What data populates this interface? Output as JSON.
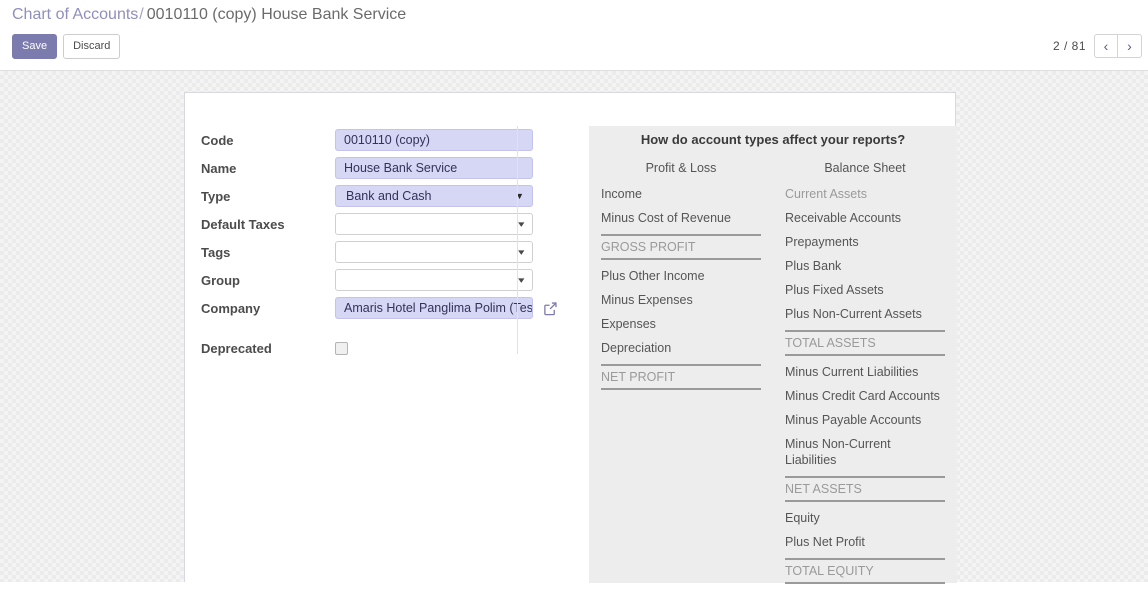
{
  "breadcrumb": {
    "root": "Chart of Accounts",
    "separator": "/",
    "current": "0010110 (copy) House Bank Service"
  },
  "toolbar": {
    "save_label": "Save",
    "discard_label": "Discard"
  },
  "pager": {
    "count": "2 / 81",
    "prev_icon": "chevron-left-icon",
    "next_icon": "chevron-right-icon",
    "prev_glyph": "‹",
    "next_glyph": "›"
  },
  "form": {
    "fields": [
      {
        "label": "Code",
        "value": "0010110 (copy)",
        "type": "text-filled"
      },
      {
        "label": "Name",
        "value": "House Bank Service",
        "type": "text-filled"
      },
      {
        "label": "Type",
        "value": "Bank and Cash",
        "type": "select-filled"
      },
      {
        "label": "Default Taxes",
        "value": "",
        "type": "select-empty"
      },
      {
        "label": "Tags",
        "value": "",
        "type": "select-empty"
      },
      {
        "label": "Group",
        "value": "",
        "type": "select-empty"
      },
      {
        "label": "Company",
        "value": "Amaris Hotel Panglima Polim (Tes",
        "type": "m2o-filled"
      },
      {
        "label": "Deprecated",
        "value": "",
        "type": "checkbox"
      }
    ]
  },
  "info_panel": {
    "title": "How do account types affect your reports?",
    "columns": [
      {
        "head": "Profit & Loss",
        "items": [
          {
            "label": "Income",
            "style": "normal"
          },
          {
            "label": "Minus Cost of Revenue",
            "style": "normal"
          },
          {
            "label": "GROSS PROFIT",
            "style": "total"
          },
          {
            "label": "Plus Other Income",
            "style": "normal"
          },
          {
            "label": "Minus Expenses",
            "style": "normal"
          },
          {
            "label": "Expenses",
            "style": "normal"
          },
          {
            "label": "Depreciation",
            "style": "normal"
          },
          {
            "label": "NET PROFIT",
            "style": "total"
          }
        ]
      },
      {
        "head": "Balance Sheet",
        "items": [
          {
            "label": "Current Assets",
            "style": "muted"
          },
          {
            "label": "Receivable Accounts",
            "style": "normal"
          },
          {
            "label": "Prepayments",
            "style": "normal"
          },
          {
            "label": "Plus Bank",
            "style": "normal"
          },
          {
            "label": "Plus Fixed Assets",
            "style": "normal"
          },
          {
            "label": "Plus Non-Current Assets",
            "style": "normal"
          },
          {
            "label": "TOTAL ASSETS",
            "style": "total"
          },
          {
            "label": "Minus Current Liabilities",
            "style": "normal"
          },
          {
            "label": "Minus Credit Card Accounts",
            "style": "normal"
          },
          {
            "label": "Minus Payable Accounts",
            "style": "normal"
          },
          {
            "label": "Minus Non-Current Liabilities",
            "style": "normal"
          },
          {
            "label": "NET ASSETS",
            "style": "total"
          },
          {
            "label": "Equity",
            "style": "normal"
          },
          {
            "label": "Plus Net Profit",
            "style": "normal"
          },
          {
            "label": "TOTAL EQUITY",
            "style": "total"
          }
        ]
      }
    ]
  },
  "colors": {
    "accent": "#7c7bad",
    "link": "#8f8fbd",
    "input_fill": "#d6d6f5",
    "panel_bg": "#ededed"
  }
}
